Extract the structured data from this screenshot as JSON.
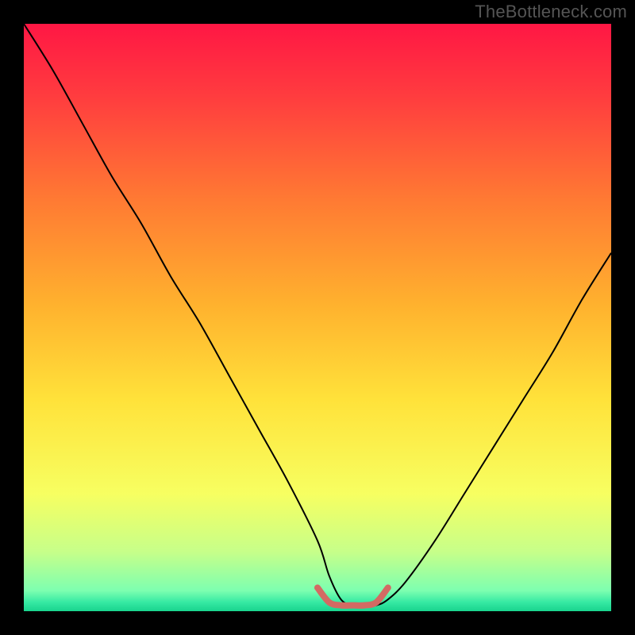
{
  "attribution": "TheBottleneck.com",
  "chart_data": {
    "type": "line",
    "title": "",
    "xlabel": "",
    "ylabel": "",
    "xlim": [
      0,
      100
    ],
    "ylim": [
      0,
      100
    ],
    "grid": false,
    "legend": false,
    "annotations": [],
    "series": [
      {
        "name": "curve",
        "stroke": "#000000",
        "x": [
          0,
          5,
          10,
          15,
          20,
          25,
          30,
          35,
          40,
          45,
          50,
          52,
          54,
          56,
          58,
          60,
          62,
          65,
          70,
          75,
          80,
          85,
          90,
          95,
          100
        ],
        "values": [
          100,
          92,
          83,
          74,
          66,
          57,
          49,
          40,
          31,
          22,
          12,
          6,
          2,
          1,
          1,
          1,
          2,
          5,
          12,
          20,
          28,
          36,
          44,
          53,
          61
        ]
      },
      {
        "name": "floor-marker",
        "stroke": "#d36a63",
        "x": [
          50,
          52,
          54,
          56,
          58,
          60,
          62
        ],
        "values": [
          4,
          1.5,
          1,
          1,
          1,
          1.5,
          4
        ]
      }
    ],
    "background_gradient": {
      "stops": [
        {
          "offset": 0.0,
          "color": "#ff1744"
        },
        {
          "offset": 0.12,
          "color": "#ff3b3f"
        },
        {
          "offset": 0.3,
          "color": "#ff7a33"
        },
        {
          "offset": 0.48,
          "color": "#ffb22e"
        },
        {
          "offset": 0.64,
          "color": "#ffe23a"
        },
        {
          "offset": 0.8,
          "color": "#f7ff61"
        },
        {
          "offset": 0.9,
          "color": "#c6ff8a"
        },
        {
          "offset": 0.965,
          "color": "#7dffb0"
        },
        {
          "offset": 0.985,
          "color": "#35e9a3"
        },
        {
          "offset": 1.0,
          "color": "#19d48e"
        }
      ]
    }
  }
}
